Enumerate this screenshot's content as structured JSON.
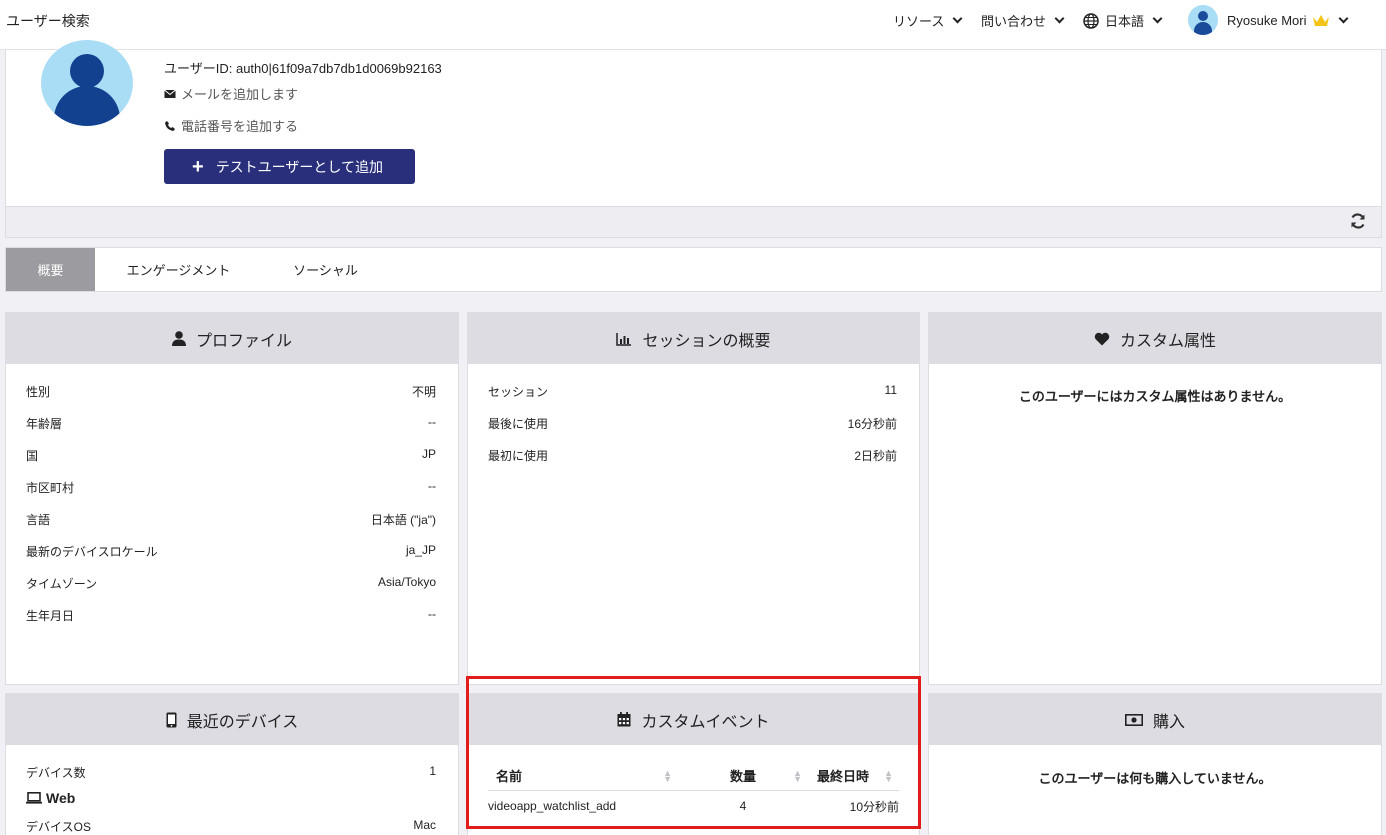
{
  "topbar": {
    "title": "ユーザー検索",
    "resources": "リソース",
    "contact": "問い合わせ",
    "language": "日本語",
    "user_name": "Ryosuke Mori"
  },
  "profile": {
    "uid": "ユーザーID: auth0|61f09a7db7db1d0069b92163",
    "add_email": "メールを追加します",
    "add_phone": "電話番号を追加する",
    "add_test_user": "テストユーザーとして追加"
  },
  "tabs": [
    {
      "label": "概要"
    },
    {
      "label": "エンゲージメント"
    },
    {
      "label": "ソーシャル"
    }
  ],
  "profile_card": {
    "title": "プロファイル",
    "rows": [
      {
        "label": "性別",
        "value": "不明"
      },
      {
        "label": "年齢層",
        "value": "--"
      },
      {
        "label": "国",
        "value": "JP"
      },
      {
        "label": "市区町村",
        "value": "--"
      },
      {
        "label": "言語",
        "value": "日本語 (\"ja\")"
      },
      {
        "label": "最新のデバイスロケール",
        "value": "ja_JP"
      },
      {
        "label": "タイムゾーン",
        "value": "Asia/Tokyo"
      },
      {
        "label": "生年月日",
        "value": "--"
      }
    ]
  },
  "session_card": {
    "title": "セッションの概要",
    "rows": [
      {
        "label": "セッション",
        "value": "11"
      },
      {
        "label": "最後に使用",
        "value": "16分秒前"
      },
      {
        "label": "最初に使用",
        "value": "2日秒前"
      }
    ]
  },
  "custom_attr_card": {
    "title": "カスタム属性",
    "empty": "このユーザーにはカスタム属性はありません。"
  },
  "devices_card": {
    "title": "最近のデバイス",
    "count_label": "デバイス数",
    "count_value": "1",
    "platform": "Web",
    "os_label": "デバイスOS",
    "os_value": "Mac"
  },
  "events_card": {
    "title": "カスタムイベント",
    "col_name": "名前",
    "col_count": "数量",
    "col_last": "最終日時",
    "rows": [
      {
        "name": "videoapp_watchlist_add",
        "count": "4",
        "last": "10分秒前"
      }
    ]
  },
  "purchase_card": {
    "title": "購入",
    "empty": "このユーザーは何も購入していません。"
  },
  "colors": {
    "accent": "#2a2f7c",
    "highlight": "#e21b1b",
    "card_header": "#dcdce2"
  }
}
